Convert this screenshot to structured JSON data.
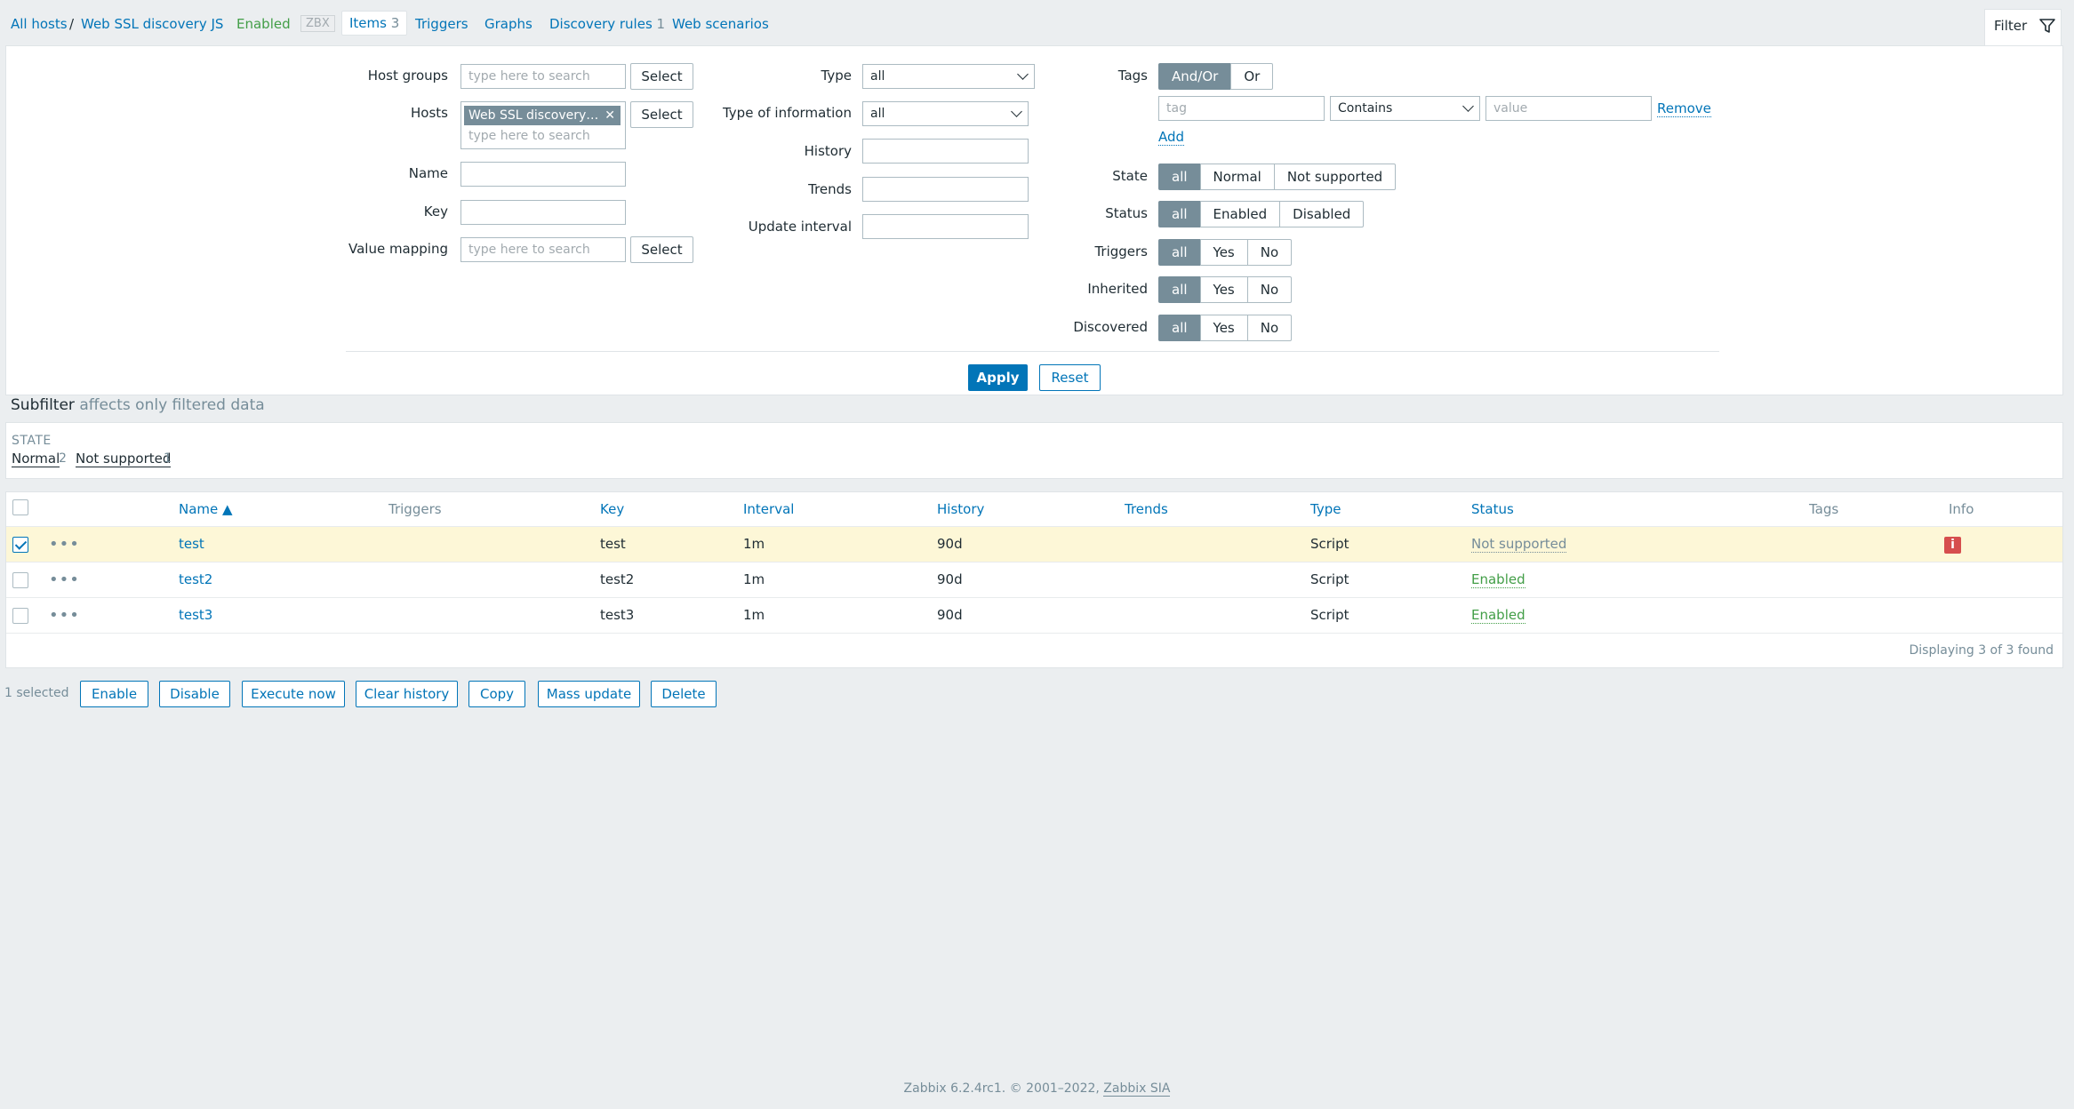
{
  "nav": {
    "all_hosts": "All hosts",
    "separator": "/",
    "host_name": "Web SSL discovery JS",
    "status": "Enabled",
    "zbx": "ZBX",
    "items_label": "Items",
    "items_count": "3",
    "triggers": "Triggers",
    "graphs": "Graphs",
    "discovery_rules": "Discovery rules",
    "discovery_count": "1",
    "web_scenarios": "Web scenarios",
    "filter_tab": "Filter"
  },
  "filter": {
    "host_groups_label": "Host groups",
    "host_groups_placeholder": "type here to search",
    "select_label": "Select",
    "hosts_label": "Hosts",
    "hosts_chip": "Web SSL discovery…",
    "hosts_placeholder": "type here to search",
    "name_label": "Name",
    "key_label": "Key",
    "value_mapping_label": "Value mapping",
    "value_mapping_placeholder": "type here to search",
    "type_label": "Type",
    "type_value": "all",
    "type_info_label": "Type of information",
    "type_info_value": "all",
    "history_label": "History",
    "trends_label": "Trends",
    "update_interval_label": "Update interval",
    "tags_label": "Tags",
    "tags_mode": [
      "And/Or",
      "Or"
    ],
    "tag_placeholder": "tag",
    "tag_operator": "Contains",
    "value_placeholder": "value",
    "remove_label": "Remove",
    "add_label": "Add",
    "state_label": "State",
    "state_options": [
      "all",
      "Normal",
      "Not supported"
    ],
    "status_label": "Status",
    "status_options": [
      "all",
      "Enabled",
      "Disabled"
    ],
    "triggers_label": "Triggers",
    "inherited_label": "Inherited",
    "discovered_label": "Discovered",
    "yesno_options": [
      "all",
      "Yes",
      "No"
    ],
    "apply": "Apply",
    "reset": "Reset"
  },
  "subfilter": {
    "title": "Subfilter",
    "hint": "affects only filtered data",
    "state_heading": "STATE",
    "normal": "Normal",
    "normal_count": "2",
    "not_supported": "Not supported",
    "not_supported_count": "1"
  },
  "table": {
    "headers": {
      "name": "Name ▲",
      "triggers": "Triggers",
      "key": "Key",
      "interval": "Interval",
      "history": "History",
      "trends": "Trends",
      "type": "Type",
      "status": "Status",
      "tags": "Tags",
      "info": "Info"
    },
    "rows": [
      {
        "name": "test",
        "key": "test",
        "interval": "1m",
        "history": "90d",
        "type": "Script",
        "status": "Not supported",
        "info": "i"
      },
      {
        "name": "test2",
        "key": "test2",
        "interval": "1m",
        "history": "90d",
        "type": "Script",
        "status": "Enabled"
      },
      {
        "name": "test3",
        "key": "test3",
        "interval": "1m",
        "history": "90d",
        "type": "Script",
        "status": "Enabled"
      }
    ],
    "displaying": "Displaying 3 of 3 found"
  },
  "actions": {
    "selected": "1 selected",
    "enable": "Enable",
    "disable": "Disable",
    "execute_now": "Execute now",
    "clear_history": "Clear history",
    "copy": "Copy",
    "mass_update": "Mass update",
    "delete": "Delete"
  },
  "footer": {
    "text": "Zabbix 6.2.4rc1. © 2001–2022, ",
    "company": "Zabbix SIA"
  },
  "colors": {
    "accent": "#0275b8",
    "enabled": "#429e47",
    "problem": "#d64e4e",
    "selected_row": "#fdf7d7"
  }
}
